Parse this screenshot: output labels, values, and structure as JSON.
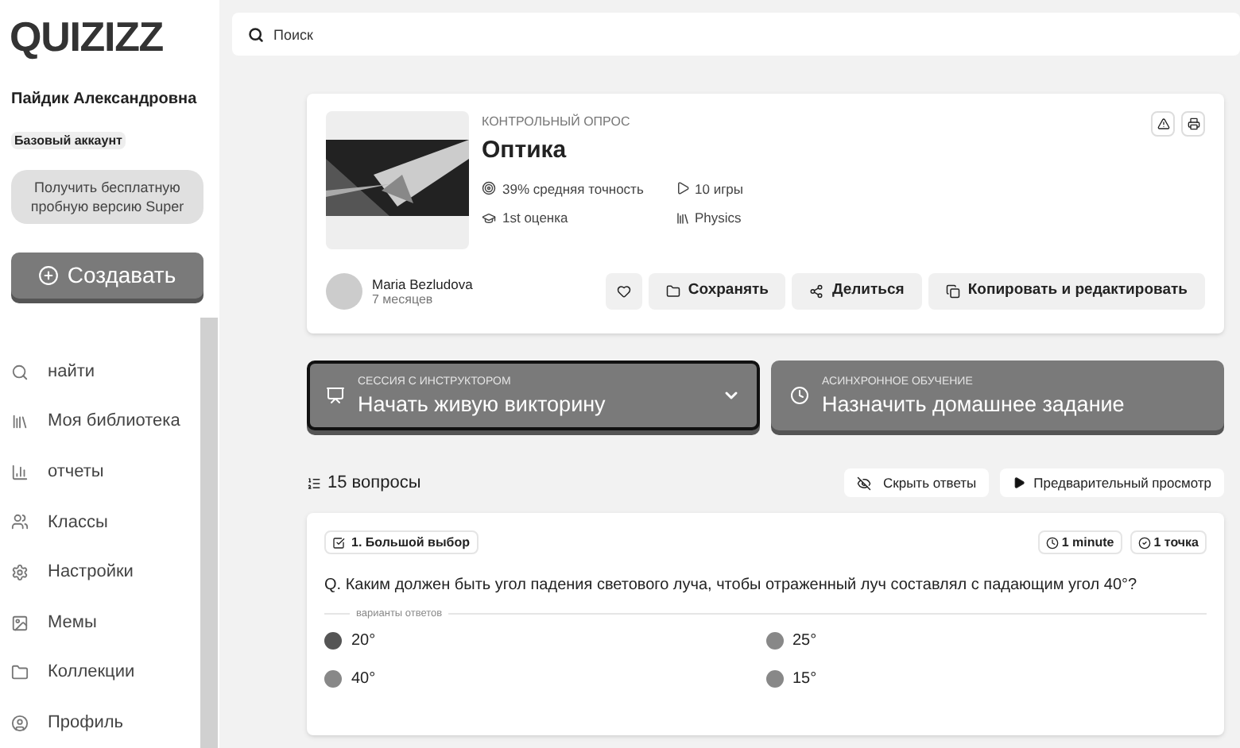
{
  "logo": "QUIZIZZ",
  "user": {
    "name": "Пайдик Александровна",
    "plan": "Базовый аккаунт"
  },
  "trial_button": "Получить бесплатную пробную версию Super",
  "create_button": "Создавать",
  "nav": [
    {
      "label": "найти",
      "kind": "search"
    },
    {
      "label": "Моя библиотека",
      "kind": "library"
    },
    {
      "label": "отчеты",
      "kind": "reports"
    },
    {
      "label": "Классы",
      "kind": "classes"
    },
    {
      "label": "Настройки",
      "kind": "settings"
    },
    {
      "label": "Мемы",
      "kind": "memes"
    },
    {
      "label": "Коллекции",
      "kind": "folder"
    },
    {
      "label": "Профиль",
      "kind": "profile"
    }
  ],
  "search": {
    "placeholder": "Поиск"
  },
  "quiz": {
    "type": "КОНТРОЛЬНЫЙ ОПРОС",
    "title": "Оптика",
    "accuracy": "39% средняя точность",
    "plays": "10 игры",
    "grade": "1st оценка",
    "subject": "Physics",
    "author": "Maria Bezludova",
    "age": "7 месяцев",
    "actions": [
      {
        "label": "Сохранять",
        "kind": "save"
      },
      {
        "label": "Делиться",
        "kind": "share"
      },
      {
        "label": "Копировать и редактировать",
        "kind": "copy"
      }
    ]
  },
  "modes": [
    {
      "kind": "live",
      "caption": "СЕССИЯ С ИНСТРУКТОРОМ",
      "label": "Начать живую викторину",
      "selected": true
    },
    {
      "kind": "homework",
      "caption": "АСИНХРОННОЕ ОБУЧЕНИЕ",
      "label": "Назначить домашнее задание",
      "selected": false
    }
  ],
  "questions_count": "15 вопросы",
  "hide_answers": "Скрыть ответы",
  "preview": "Предварительный просмотр",
  "question": {
    "type": "1. Большой выбор",
    "time": "1 minute",
    "points": "1 точка",
    "text": "Q. Каким должен быть угол падения светового луча, чтобы отраженный луч составлял с падающим угол 40°?",
    "options_caption": "варианты ответов",
    "options": [
      {
        "text": "20°",
        "correct": true
      },
      {
        "text": "25°",
        "correct": false
      },
      {
        "text": "40°",
        "correct": false
      },
      {
        "text": "15°",
        "correct": false
      }
    ]
  }
}
